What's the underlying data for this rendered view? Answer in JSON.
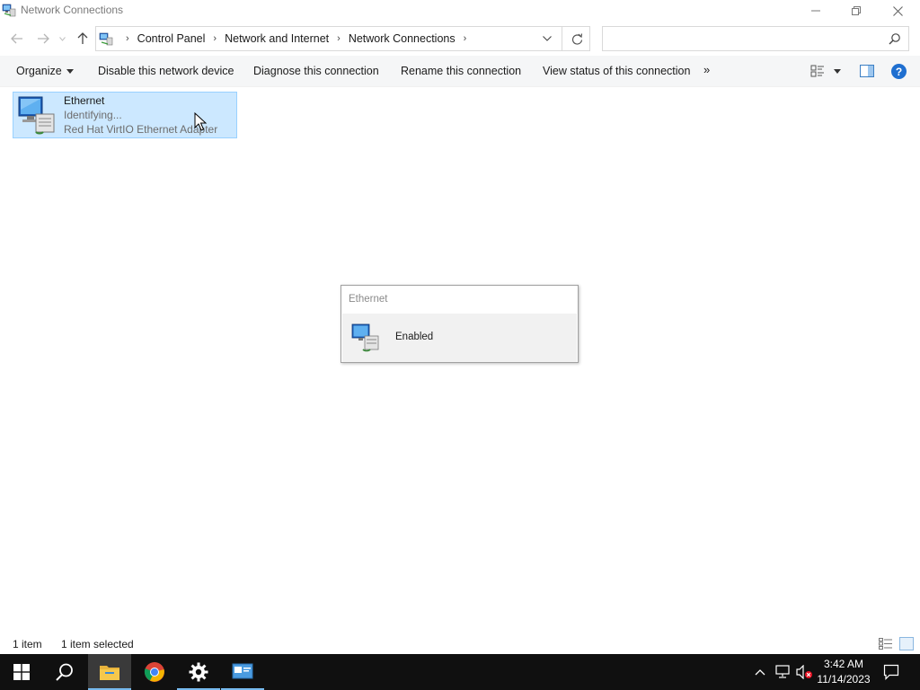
{
  "window": {
    "title": "Network Connections"
  },
  "address": {
    "crumbs": [
      "Control Panel",
      "Network and Internet",
      "Network Connections"
    ],
    "search_placeholder": ""
  },
  "commands": {
    "organize": "Organize",
    "disable": "Disable this network device",
    "diagnose": "Diagnose this connection",
    "rename": "Rename this connection",
    "view_status": "View status of this connection",
    "more": "»"
  },
  "items": [
    {
      "name": "Ethernet",
      "status": "Identifying...",
      "device": "Red Hat VirtIO Ethernet Adapter",
      "selected": true
    }
  ],
  "popup": {
    "title": "Ethernet",
    "label": "Enabled"
  },
  "status_bar": {
    "count": "1 item",
    "selected": "1 item selected"
  },
  "taskbar": {
    "time": "3:42 AM",
    "date": "11/14/2023",
    "apps": [
      "start-icon",
      "search-icon",
      "file-explorer-icon",
      "chrome-icon",
      "settings-icon",
      "network-connections-icon"
    ]
  },
  "colors": {
    "selection_bg": "#cce8ff",
    "selection_border": "#99d1ff",
    "taskbar_bg": "#101010",
    "accent": "#1f6fd0"
  }
}
